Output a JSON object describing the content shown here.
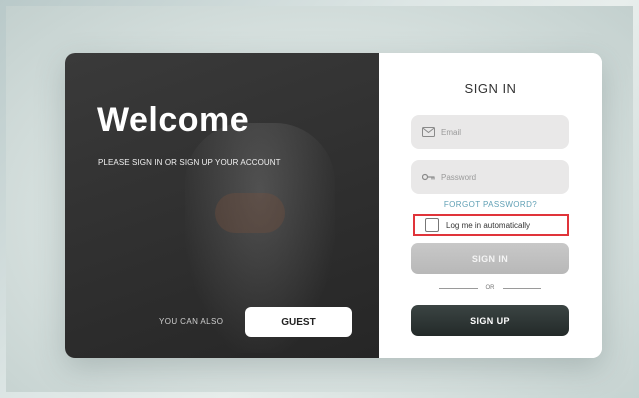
{
  "left": {
    "heading": "Welcome",
    "subtitle": "PLEASE SIGN IN OR SIGN UP YOUR ACCOUNT",
    "also_text": "YOU CAN ALSO",
    "guest_label": "GUEST"
  },
  "right": {
    "title": "SIGN IN",
    "email_placeholder": "Email",
    "email_icon": "envelope-icon",
    "password_placeholder": "Password",
    "password_icon": "key-icon",
    "forgot_label": "FORGOT PASSWORD?",
    "remember_label": "Log me in automatically",
    "remember_checked": false,
    "signin_label": "SIGN IN",
    "or_label": "OR",
    "signup_label": "SIGN UP"
  },
  "colors": {
    "highlight_border": "#e0343a",
    "forgot_link": "#5f9fb4",
    "signup_button": "#2c3332",
    "left_panel": "#2f2f2f"
  }
}
